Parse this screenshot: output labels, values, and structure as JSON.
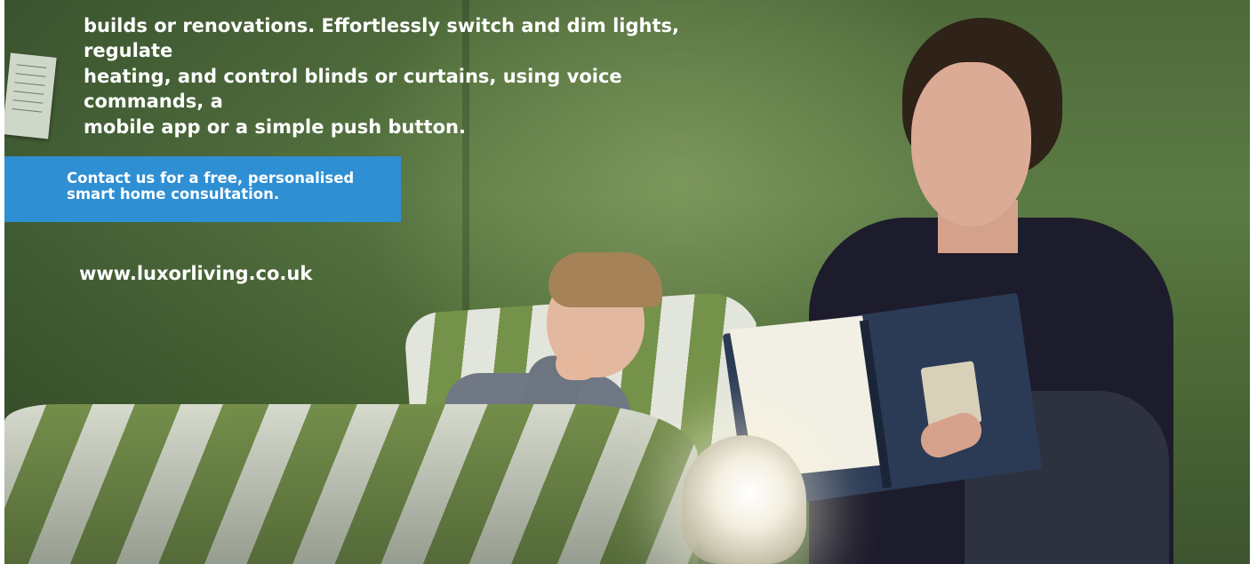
{
  "ad": {
    "body_lines": [
      "builds or renovations. Effortlessly switch and dim lights, regulate",
      "heating, and control blinds or curtains, using voice commands, a",
      "mobile app or a simple push button."
    ],
    "cta_label": "Contact us for a free, personalised smart home consultation.",
    "website": "www.luxorliving.co.uk",
    "colors": {
      "cta_background": "#2f8fd3",
      "text": "#ffffff",
      "wall": "#5b7a44"
    }
  }
}
